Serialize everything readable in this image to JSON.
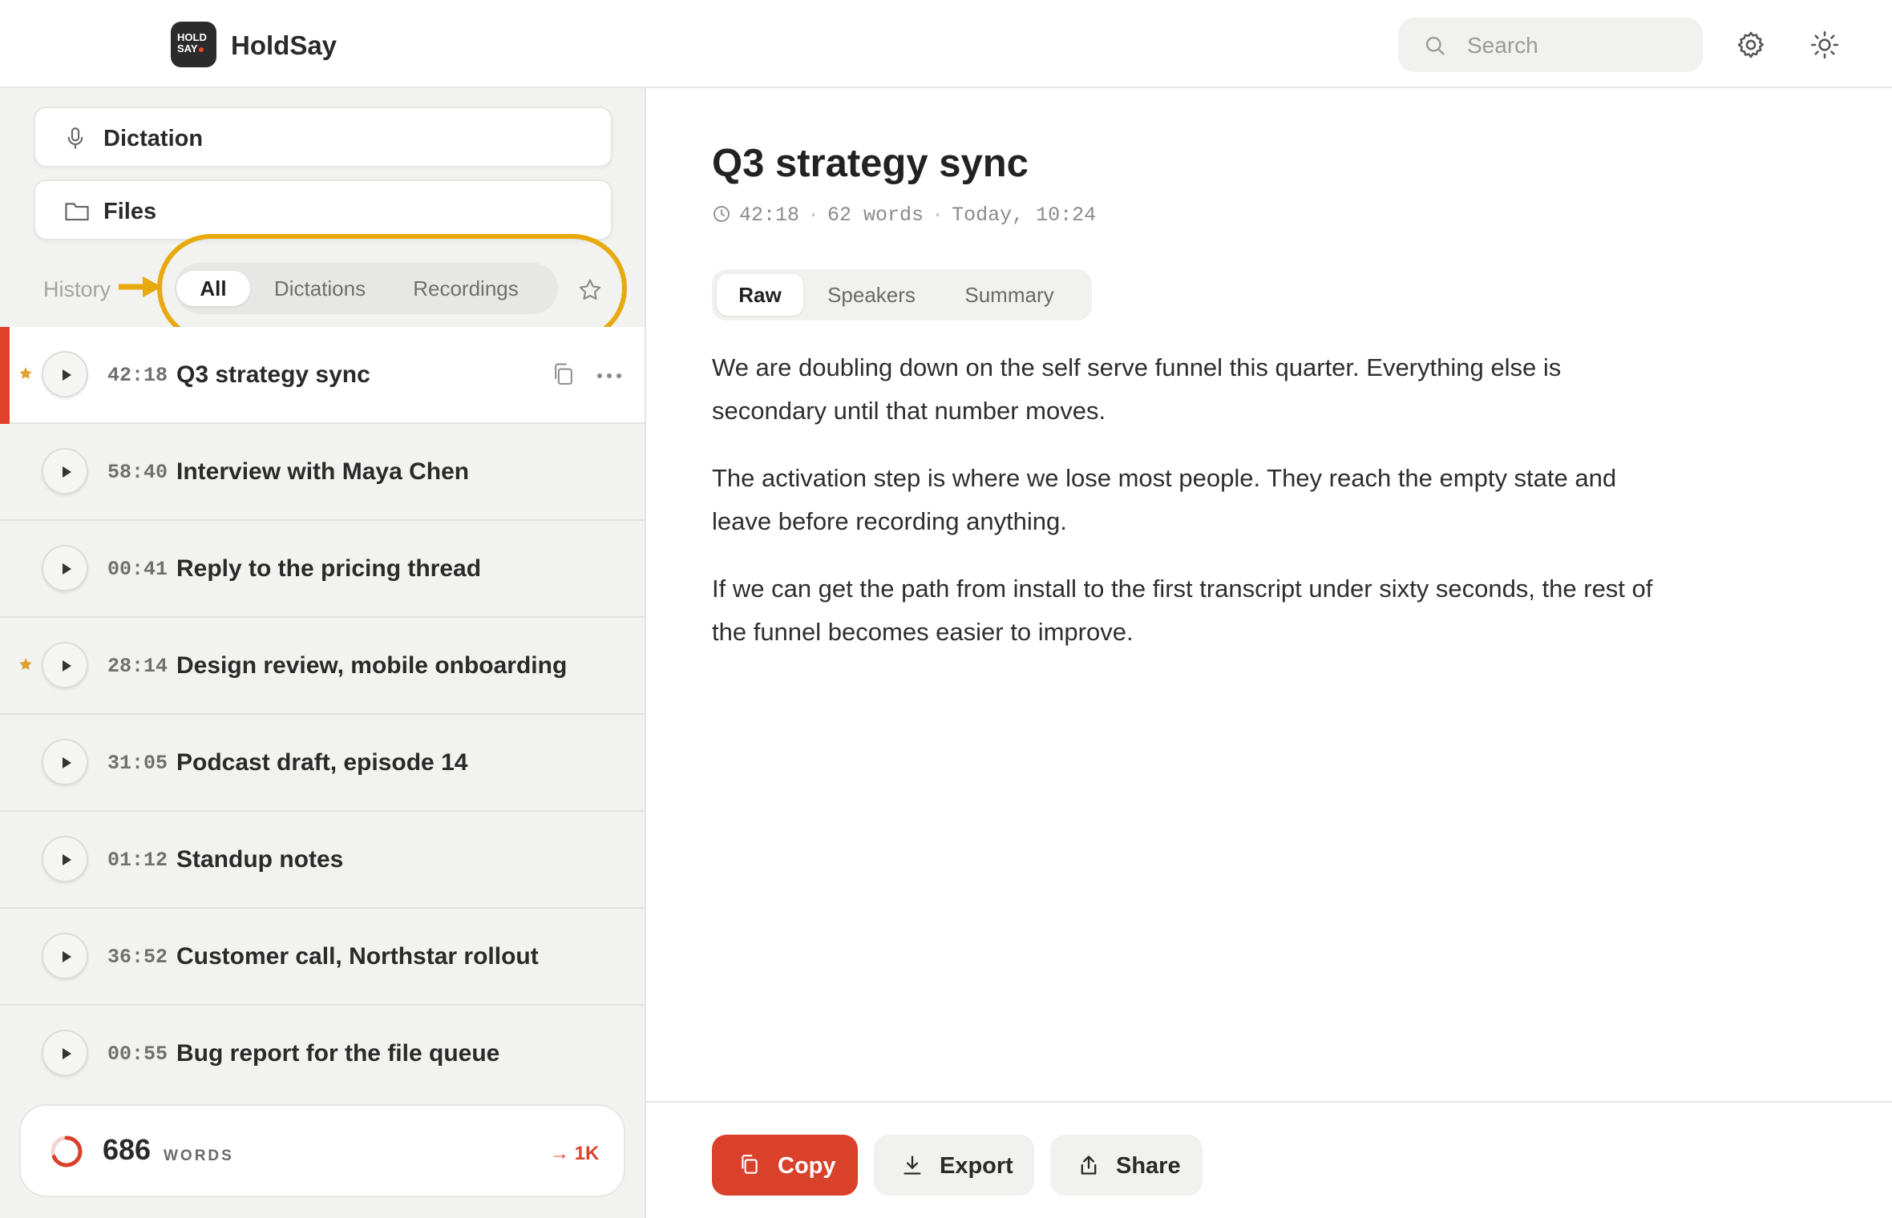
{
  "app": {
    "logo_text_line1": "HOLD",
    "logo_text_line2": "SAY",
    "name": "HoldSay"
  },
  "search": {
    "placeholder": "Search"
  },
  "sidebar": {
    "nav": [
      {
        "label": "Dictation",
        "icon": "microphone-icon"
      },
      {
        "label": "Files",
        "icon": "folder-icon"
      }
    ],
    "history_label": "History",
    "filters": [
      "All",
      "Dictations",
      "Recordings"
    ],
    "active_filter": "All",
    "items": [
      {
        "duration": "42:18",
        "title": "Q3 strategy sync",
        "starred": true,
        "selected": true
      },
      {
        "duration": "58:40",
        "title": "Interview with Maya Chen",
        "starred": false
      },
      {
        "duration": "00:41",
        "title": "Reply to the pricing thread",
        "starred": false
      },
      {
        "duration": "28:14",
        "title": "Design review, mobile onboarding",
        "starred": true
      },
      {
        "duration": "31:05",
        "title": "Podcast draft, episode 14",
        "starred": false
      },
      {
        "duration": "01:12",
        "title": "Standup notes",
        "starred": false
      },
      {
        "duration": "36:52",
        "title": "Customer call, Northstar rollout",
        "starred": false
      },
      {
        "duration": "00:55",
        "title": "Bug report for the file queue",
        "starred": false
      }
    ],
    "word_stats": {
      "count": "686",
      "unit": "WORDS",
      "goal": "→ 1K",
      "progress": 0.686
    }
  },
  "document": {
    "title": "Q3 strategy sync",
    "duration": "42:18",
    "word_count": "62 words",
    "timestamp": "Today, 10:24",
    "tabs": [
      "Raw",
      "Speakers",
      "Summary"
    ],
    "active_tab": "Raw",
    "paragraphs": [
      "We are doubling down on the self serve funnel this quarter. Everything else is secondary until that number moves.",
      "The activation step is where we lose most people. They reach the empty state and leave before recording anything.",
      "If we can get the path from install to the first transcript under sixty seconds, the rest of the funnel becomes easier to improve."
    ]
  },
  "actions": {
    "copy": "Copy",
    "export": "Export",
    "share": "Share"
  },
  "colors": {
    "accent": "#d9412b",
    "highlight": "#e8a90e",
    "star": "#e0a030"
  }
}
